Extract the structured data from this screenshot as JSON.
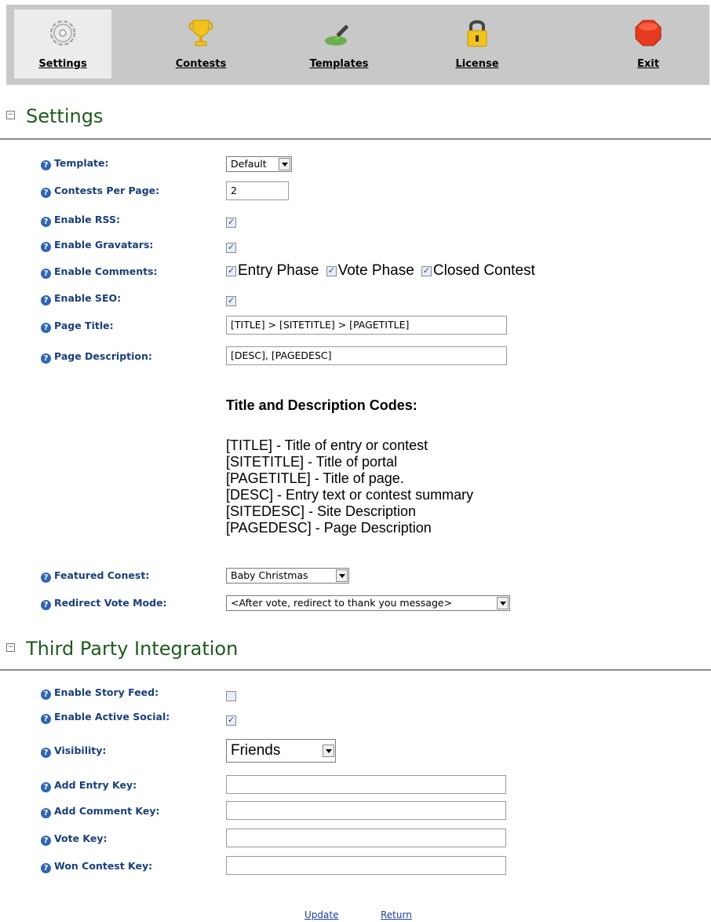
{
  "toolbar": {
    "items": [
      {
        "label": "Settings",
        "icon": "gear-icon",
        "active": true
      },
      {
        "label": "Contests",
        "icon": "trophy-icon",
        "active": false
      },
      {
        "label": "Templates",
        "icon": "brush-icon",
        "active": false
      },
      {
        "label": "License",
        "icon": "lock-icon",
        "active": false
      },
      {
        "label": "Exit",
        "icon": "stop-icon",
        "active": false
      }
    ]
  },
  "settings": {
    "title": "Settings",
    "template": {
      "label": "Template:",
      "value": "Default"
    },
    "contests_per_page": {
      "label": "Contests Per Page:",
      "value": "2"
    },
    "enable_rss": {
      "label": "Enable RSS:",
      "checked": true
    },
    "enable_gravatars": {
      "label": "Enable Gravatars:",
      "checked": true
    },
    "enable_comments": {
      "label": "Enable Comments:",
      "options": [
        {
          "label": "Entry Phase",
          "checked": true
        },
        {
          "label": "Vote Phase",
          "checked": true
        },
        {
          "label": "Closed Contest",
          "checked": true
        }
      ]
    },
    "enable_seo": {
      "label": "Enable SEO:",
      "checked": true
    },
    "page_title": {
      "label": "Page Title:",
      "value": "[TITLE] > [SITETITLE] > [PAGETITLE]"
    },
    "page_description": {
      "label": "Page Description:",
      "value": "[DESC], [PAGEDESC]"
    },
    "codes": {
      "title": "Title and Description Codes:",
      "lines": [
        "[TITLE] - Title of entry or contest",
        "[SITETITLE] - Title of portal",
        "[PAGETITLE] - Title of page.",
        "[DESC] - Entry text or contest summary",
        "[SITEDESC] - Site Description",
        "[PAGEDESC] - Page Description"
      ]
    },
    "featured_contest": {
      "label": "Featured Conest:",
      "value": "Baby Christmas"
    },
    "redirect_vote_mode": {
      "label": "Redirect Vote Mode:",
      "value": "<After vote, redirect to thank you message>"
    }
  },
  "third_party": {
    "title": "Third Party Integration",
    "enable_story_feed": {
      "label": "Enable Story Feed:",
      "checked": false
    },
    "enable_active_social": {
      "label": "Enable Active Social:",
      "checked": true
    },
    "visibility": {
      "label": "Visibility:",
      "value": "Friends"
    },
    "add_entry_key": {
      "label": "Add Entry Key:",
      "value": ""
    },
    "add_comment_key": {
      "label": "Add Comment Key:",
      "value": ""
    },
    "vote_key": {
      "label": "Vote Key:",
      "value": ""
    },
    "won_contest_key": {
      "label": "Won Contest Key:",
      "value": ""
    }
  },
  "footer": {
    "update": "Update",
    "return": "Return"
  },
  "colors": {
    "section_title": "#1e5a1e",
    "label": "#1a3f7a",
    "toolbar_bg": "#c8c8c8"
  }
}
